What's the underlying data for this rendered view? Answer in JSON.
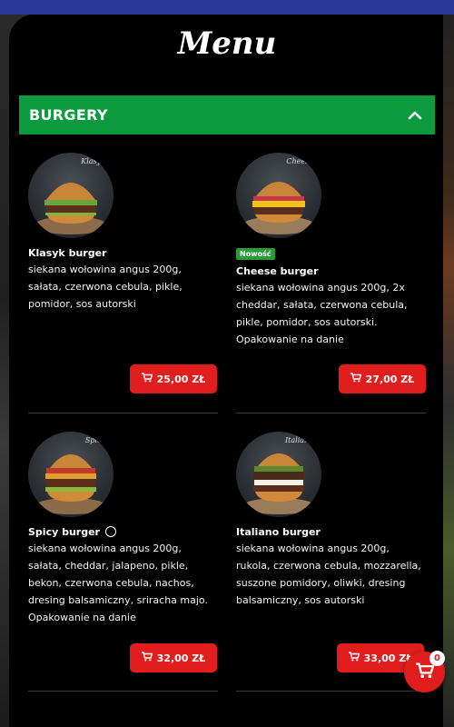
{
  "page": {
    "title": "Menu"
  },
  "category": {
    "label": "BURGERY",
    "expanded": true
  },
  "items": [
    {
      "chalk": "Klasyk",
      "name": "Klasyk burger",
      "description": "siekana wołowina angus 200g, sałata, czerwona cebula, pikle, pomidor, sos autorski",
      "price": "25,00 ZŁ"
    },
    {
      "chalk": "Cheese",
      "badge": "Nowość",
      "name": "Cheese burger",
      "description": "siekana wołowina angus 200g, 2x cheddar, sałata, czerwona cebula, pikle, pomidor, sos autorski. Opakowanie na danie",
      "price": "27,00 ZŁ"
    },
    {
      "chalk": "Spicy",
      "name": "Spicy burger",
      "description": "siekana wołowina angus 200g, sałata, cheddar, jalapeno, pikle, bekon, czerwona cebula, nachos, dresing balsamiczny, sriracha majo. Opakowanie na danie",
      "price": "32,00 ZŁ"
    },
    {
      "chalk": "Italiano",
      "name": "Italiano burger",
      "description": "siekana wołowina angus 200g, rukola, czerwona cebula, mozzarella, suszone pomidory, oliwki, dresing balsamiczny, sos autorski",
      "price": "33,00 ZŁ"
    }
  ],
  "cart": {
    "count": "0"
  },
  "colors": {
    "accent": "#e11d1d",
    "category": "#0d9a3f",
    "header": "#2b3a98"
  },
  "icons": {
    "chevron": "chevron-up-icon",
    "cart": "cart-icon",
    "spicy": "spicy-icon"
  }
}
